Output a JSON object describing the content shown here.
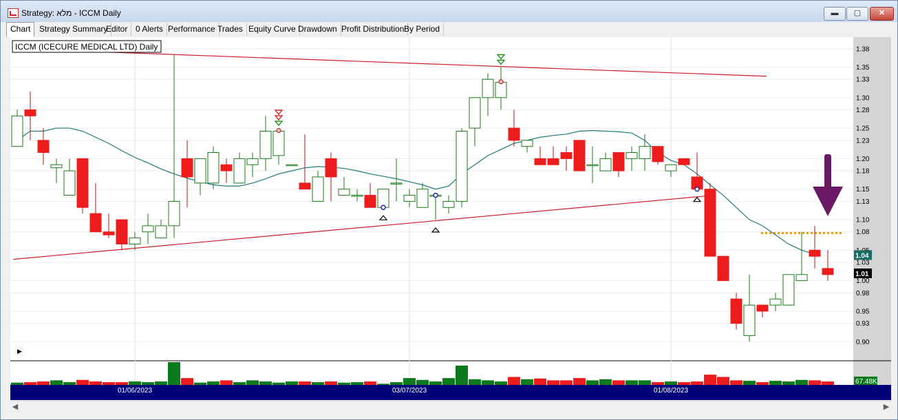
{
  "window": {
    "title": "Strategy: מלא - ICCM Daily",
    "minimize_label": "▬",
    "maximize_label": "▢",
    "close_label": "✕"
  },
  "tabs": [
    "Chart",
    "Strategy Summary",
    "Editor",
    "0 Alerts",
    "Performance",
    "Trades",
    "Equity Curve",
    "Drawdown",
    "Profit Distribution",
    "By Period"
  ],
  "active_tab": "Chart",
  "chart": {
    "legend": "ICCM (ICECURE MEDICAL LTD) Daily",
    "expand_marker": "▶",
    "volume_label": "67.48K"
  },
  "chart_data": {
    "type": "candlestick",
    "symbol": "ICCM",
    "ylim": [
      0.88,
      1.39
    ],
    "y_ticks": [
      "1.38",
      "1.35",
      "1.33",
      "1.30",
      "1.28",
      "1.25",
      "1.23",
      "1.20",
      "1.18",
      "1.15",
      "1.13",
      "1.10",
      "1.08",
      "1.05",
      "1.03",
      "1.00",
      "0.98",
      "0.95",
      "0.93",
      "0.90"
    ],
    "x_labels": [
      "01/06/2023",
      "03/07/2023",
      "01/08/2023"
    ],
    "last_price_labels": [
      {
        "text": "1.04",
        "value": 1.042,
        "color": "#1a6b63"
      },
      {
        "text": "1.01",
        "value": 1.012,
        "color": "#000000"
      }
    ],
    "candles": [
      {
        "o": 1.22,
        "h": 1.28,
        "l": 1.22,
        "c": 1.27
      },
      {
        "o": 1.28,
        "h": 1.31,
        "l": 1.23,
        "c": 1.27
      },
      {
        "o": 1.23,
        "h": 1.25,
        "l": 1.19,
        "c": 1.21
      },
      {
        "o": 1.185,
        "h": 1.2,
        "l": 1.16,
        "c": 1.19
      },
      {
        "o": 1.14,
        "h": 1.2,
        "l": 1.14,
        "c": 1.18
      },
      {
        "o": 1.2,
        "h": 1.2,
        "l": 1.11,
        "c": 1.12
      },
      {
        "o": 1.11,
        "h": 1.16,
        "l": 1.08,
        "c": 1.08
      },
      {
        "o": 1.08,
        "h": 1.11,
        "l": 1.07,
        "c": 1.075
      },
      {
        "o": 1.1,
        "h": 1.1,
        "l": 1.05,
        "c": 1.06
      },
      {
        "o": 1.06,
        "h": 1.08,
        "l": 1.05,
        "c": 1.07
      },
      {
        "o": 1.08,
        "h": 1.11,
        "l": 1.06,
        "c": 1.09
      },
      {
        "o": 1.07,
        "h": 1.1,
        "l": 1.07,
        "c": 1.09
      },
      {
        "o": 1.09,
        "h": 1.37,
        "l": 1.07,
        "c": 1.13
      },
      {
        "o": 1.2,
        "h": 1.23,
        "l": 1.12,
        "c": 1.17
      },
      {
        "o": 1.16,
        "h": 1.2,
        "l": 1.14,
        "c": 1.2
      },
      {
        "o": 1.16,
        "h": 1.22,
        "l": 1.15,
        "c": 1.21
      },
      {
        "o": 1.19,
        "h": 1.2,
        "l": 1.16,
        "c": 1.18
      },
      {
        "o": 1.16,
        "h": 1.21,
        "l": 1.16,
        "c": 1.2
      },
      {
        "o": 1.19,
        "h": 1.21,
        "l": 1.17,
        "c": 1.2
      },
      {
        "o": 1.2,
        "h": 1.27,
        "l": 1.18,
        "c": 1.245
      },
      {
        "o": 1.205,
        "h": 1.25,
        "l": 1.19,
        "c": 1.245
      },
      {
        "o": 1.19,
        "h": 1.19,
        "l": 1.19,
        "c": 1.19
      },
      {
        "o": 1.16,
        "h": 1.24,
        "l": 1.15,
        "c": 1.15
      },
      {
        "o": 1.13,
        "h": 1.18,
        "l": 1.13,
        "c": 1.17
      },
      {
        "o": 1.2,
        "h": 1.21,
        "l": 1.13,
        "c": 1.17
      },
      {
        "o": 1.14,
        "h": 1.17,
        "l": 1.14,
        "c": 1.15
      },
      {
        "o": 1.14,
        "h": 1.15,
        "l": 1.13,
        "c": 1.14
      },
      {
        "o": 1.14,
        "h": 1.16,
        "l": 1.12,
        "c": 1.12
      },
      {
        "o": 1.12,
        "h": 1.15,
        "l": 1.12,
        "c": 1.15
      },
      {
        "o": 1.16,
        "h": 1.2,
        "l": 1.13,
        "c": 1.16
      },
      {
        "o": 1.13,
        "h": 1.15,
        "l": 1.12,
        "c": 1.14
      },
      {
        "o": 1.12,
        "h": 1.16,
        "l": 1.12,
        "c": 1.15
      },
      {
        "o": 1.14,
        "h": 1.14,
        "l": 1.1,
        "c": 1.14
      },
      {
        "o": 1.12,
        "h": 1.14,
        "l": 1.11,
        "c": 1.13
      },
      {
        "o": 1.13,
        "h": 1.25,
        "l": 1.12,
        "c": 1.245
      },
      {
        "o": 1.25,
        "h": 1.3,
        "l": 1.22,
        "c": 1.3
      },
      {
        "o": 1.3,
        "h": 1.34,
        "l": 1.27,
        "c": 1.33
      },
      {
        "o": 1.3,
        "h": 1.35,
        "l": 1.28,
        "c": 1.325
      },
      {
        "o": 1.25,
        "h": 1.28,
        "l": 1.22,
        "c": 1.23
      },
      {
        "o": 1.22,
        "h": 1.23,
        "l": 1.21,
        "c": 1.23
      },
      {
        "o": 1.2,
        "h": 1.22,
        "l": 1.19,
        "c": 1.19
      },
      {
        "o": 1.2,
        "h": 1.22,
        "l": 1.19,
        "c": 1.19
      },
      {
        "o": 1.21,
        "h": 1.22,
        "l": 1.18,
        "c": 1.2
      },
      {
        "o": 1.23,
        "h": 1.23,
        "l": 1.18,
        "c": 1.18
      },
      {
        "o": 1.19,
        "h": 1.22,
        "l": 1.16,
        "c": 1.19
      },
      {
        "o": 1.18,
        "h": 1.21,
        "l": 1.18,
        "c": 1.2
      },
      {
        "o": 1.21,
        "h": 1.21,
        "l": 1.17,
        "c": 1.18
      },
      {
        "o": 1.2,
        "h": 1.22,
        "l": 1.18,
        "c": 1.21
      },
      {
        "o": 1.2,
        "h": 1.24,
        "l": 1.18,
        "c": 1.22
      },
      {
        "o": 1.22,
        "h": 1.22,
        "l": 1.19,
        "c": 1.195
      },
      {
        "o": 1.18,
        "h": 1.19,
        "l": 1.17,
        "c": 1.19
      },
      {
        "o": 1.2,
        "h": 1.2,
        "l": 1.19,
        "c": 1.19
      },
      {
        "o": 1.17,
        "h": 1.21,
        "l": 1.15,
        "c": 1.15
      },
      {
        "o": 1.15,
        "h": 1.16,
        "l": 1.04,
        "c": 1.04
      },
      {
        "o": 1.04,
        "h": 1.04,
        "l": 1.0,
        "c": 1.0
      },
      {
        "o": 0.97,
        "h": 0.98,
        "l": 0.92,
        "c": 0.93
      },
      {
        "o": 0.91,
        "h": 1.01,
        "l": 0.9,
        "c": 0.96
      },
      {
        "o": 0.96,
        "h": 0.96,
        "l": 0.94,
        "c": 0.95
      },
      {
        "o": 0.96,
        "h": 0.98,
        "l": 0.95,
        "c": 0.97
      },
      {
        "o": 0.96,
        "h": 1.01,
        "l": 0.96,
        "c": 1.01
      },
      {
        "o": 1.0,
        "h": 1.08,
        "l": 1.0,
        "c": 1.01
      },
      {
        "o": 1.05,
        "h": 1.09,
        "l": 1.02,
        "c": 1.04
      },
      {
        "o": 1.02,
        "h": 1.05,
        "l": 1.0,
        "c": 1.01
      }
    ],
    "volume": [
      0.1,
      0.12,
      0.15,
      0.2,
      0.12,
      0.22,
      0.15,
      0.12,
      0.12,
      0.15,
      0.12,
      0.15,
      1.0,
      0.3,
      0.1,
      0.15,
      0.2,
      0.12,
      0.2,
      0.15,
      0.1,
      0.15,
      0.15,
      0.12,
      0.15,
      0.1,
      0.12,
      0.15,
      0.05,
      0.12,
      0.3,
      0.22,
      0.15,
      0.3,
      0.85,
      0.25,
      0.2,
      0.15,
      0.35,
      0.25,
      0.28,
      0.2,
      0.2,
      0.3,
      0.2,
      0.25,
      0.2,
      0.2,
      0.2,
      0.12,
      0.15,
      0.12,
      0.15,
      0.45,
      0.35,
      0.2,
      0.18,
      0.12,
      0.18,
      0.15,
      0.22,
      0.2,
      0.15
    ],
    "moving_average": [
      1.23,
      1.245,
      1.245,
      1.25,
      1.25,
      1.245,
      1.235,
      1.225,
      1.213,
      1.202,
      1.193,
      1.183,
      1.175,
      1.168,
      1.162,
      1.157,
      1.155,
      1.155,
      1.16,
      1.167,
      1.175,
      1.18,
      1.185,
      1.187,
      1.186,
      1.184,
      1.18,
      1.175,
      1.171,
      1.167,
      1.162,
      1.157,
      1.15,
      1.155,
      1.175,
      1.19,
      1.205,
      1.215,
      1.225,
      1.23,
      1.235,
      1.238,
      1.24,
      1.245,
      1.246,
      1.245,
      1.244,
      1.242,
      1.23,
      1.21,
      1.197,
      1.19,
      1.175,
      1.157,
      1.14,
      1.12,
      1.1,
      1.09,
      1.075,
      1.06,
      1.05,
      1.043
    ],
    "trendlines": [
      {
        "x1": 0,
        "y1": 1.38,
        "x2": 57,
        "y2": 1.335,
        "color": "#cc1f2a"
      },
      {
        "x1": -0.3,
        "y1": 1.035,
        "x2": 53,
        "y2": 1.14,
        "color": "#cc1f2a"
      }
    ],
    "resistance": {
      "x1": 57,
      "x2": 63,
      "value": 1.078,
      "color": "#e69a22"
    },
    "signals": {
      "sell_arrows": [
        20,
        37
      ],
      "buy_triangles": [
        28,
        32,
        52
      ],
      "circle_red": [
        20,
        37
      ],
      "circle_blue": [
        28,
        32,
        52
      ]
    },
    "highlight_arrow": {
      "x": 62,
      "value": 1.1,
      "color": "#6b1a66"
    },
    "date_label_index": [
      9,
      30,
      50
    ]
  }
}
